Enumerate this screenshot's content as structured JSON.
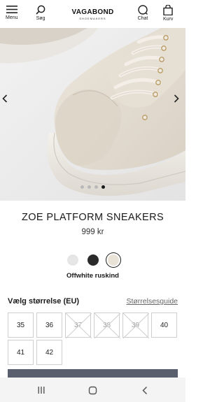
{
  "header": {
    "menu_label": "Menu",
    "search_label": "Søg",
    "brand_name": "VAGABOND",
    "brand_sub": "SHOEMAKERS",
    "chat_label": "Chat",
    "cart_label": "Kurv"
  },
  "gallery": {
    "image_count": 4,
    "active_index": 4
  },
  "product": {
    "title": "ZOE PLATFORM SNEAKERS",
    "price": "999 kr",
    "colors": [
      {
        "name": "white",
        "hex": "#e6e6e6",
        "selected": false
      },
      {
        "name": "black",
        "hex": "#2a2a2a",
        "selected": false
      },
      {
        "name": "offwhite",
        "hex": "#e9e2d6",
        "selected": true
      }
    ],
    "color_name": "Offwhite ruskind"
  },
  "sizes": {
    "heading": "Vælg størrelse (EU)",
    "guide_link": "Størrelsesguide",
    "options": [
      {
        "label": "35",
        "available": true
      },
      {
        "label": "36",
        "available": true
      },
      {
        "label": "37",
        "available": false
      },
      {
        "label": "38",
        "available": false
      },
      {
        "label": "39",
        "available": false
      },
      {
        "label": "40",
        "available": true
      },
      {
        "label": "41",
        "available": true
      },
      {
        "label": "42",
        "available": true
      }
    ]
  },
  "theme": {
    "accent": "#5a5f6e",
    "text": "#1a1a1a",
    "hero_bg": "#ececec"
  }
}
